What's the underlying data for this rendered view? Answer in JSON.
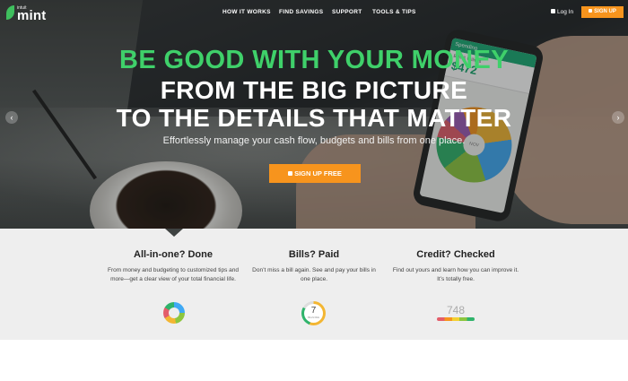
{
  "nav": {
    "logo_small": "intuit",
    "logo_text": "mint",
    "links": [
      "HOW IT WORKS",
      "FIND SAVINGS",
      "SUPPORT",
      "TOOLS & TIPS"
    ],
    "login_label": "Log In",
    "signup_label": "SIGN UP"
  },
  "hero": {
    "headline_1": "BE GOOD WITH YOUR MONEY",
    "headline_2": "FROM THE BIG PICTURE",
    "headline_3": "TO THE DETAILS THAT MATTER",
    "subheadline": "Effortlessly manage your cash flow, budgets and bills from one place.",
    "cta_label": "SIGN UP FREE",
    "prev_arrow": "‹",
    "next_arrow": "›",
    "phone": {
      "header": "Spending",
      "row_label": "Bills & Utilities",
      "amount": "$472",
      "pie_center": "NOV"
    }
  },
  "features": [
    {
      "title": "All-in-one? Done",
      "desc": "From money and budgeting to customized tips and more—get a clear view of your total financial life."
    },
    {
      "title": "Bills? Paid",
      "desc": "Don’t miss a bill again. See and pay your bills in one place.",
      "widget_number": "7",
      "widget_caption": "BILLS DUE"
    },
    {
      "title": "Credit? Checked",
      "desc": "Find out yours and learn how you can improve it. It’s totally free.",
      "widget_score": "748"
    }
  ],
  "colors": {
    "brand_green": "#3fd06a",
    "accent_orange": "#f7941d",
    "feature_bg": "#eeeeee"
  }
}
